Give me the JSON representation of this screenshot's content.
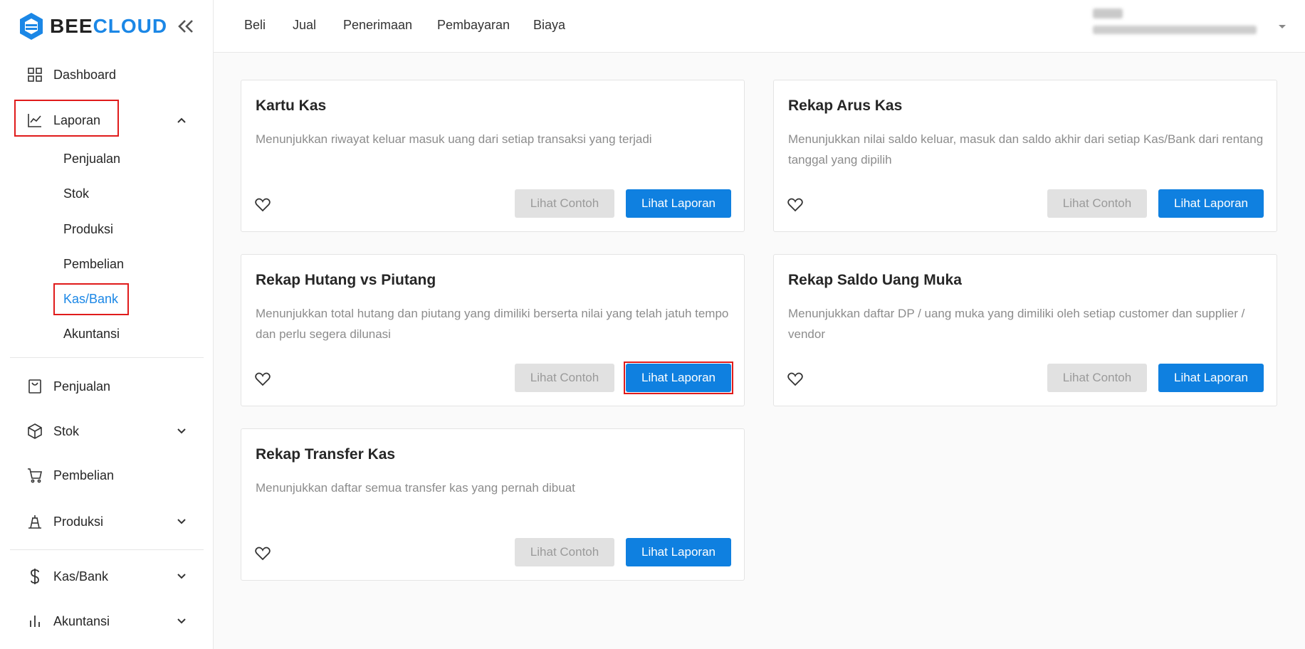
{
  "logo": {
    "part1": "BEE",
    "part2": "CLOUD"
  },
  "sidebar": {
    "items": [
      {
        "label": "Dashboard"
      },
      {
        "label": "Laporan"
      },
      {
        "label": "Penjualan"
      },
      {
        "label": "Stok"
      },
      {
        "label": "Pembelian"
      },
      {
        "label": "Produksi"
      },
      {
        "label": "Kas/Bank"
      },
      {
        "label": "Akuntansi"
      }
    ],
    "laporan_sub": [
      {
        "label": "Penjualan"
      },
      {
        "label": "Stok"
      },
      {
        "label": "Produksi"
      },
      {
        "label": "Pembelian"
      },
      {
        "label": "Kas/Bank",
        "active": true
      },
      {
        "label": "Akuntansi"
      }
    ]
  },
  "topbar": {
    "menu": [
      {
        "label": "Beli"
      },
      {
        "label": "Jual"
      },
      {
        "label": "Penerimaan"
      },
      {
        "label": "Pembayaran"
      },
      {
        "label": "Biaya"
      }
    ]
  },
  "cards": [
    {
      "title": "Kartu Kas",
      "desc": "Menunjukkan riwayat keluar masuk uang dari setiap transaksi yang terjadi",
      "example_label": "Lihat Contoh",
      "report_label": "Lihat Laporan"
    },
    {
      "title": "Rekap Arus Kas",
      "desc": "Menunjukkan nilai saldo keluar, masuk dan saldo akhir dari setiap Kas/Bank dari rentang tanggal yang dipilih",
      "example_label": "Lihat Contoh",
      "report_label": "Lihat Laporan"
    },
    {
      "title": "Rekap Hutang vs Piutang",
      "desc": "Menunjukkan total hutang dan piutang yang dimiliki berserta nilai yang telah jatuh tempo dan perlu segera dilunasi",
      "example_label": "Lihat Contoh",
      "report_label": "Lihat Laporan"
    },
    {
      "title": "Rekap Saldo Uang Muka",
      "desc": "Menunjukkan daftar DP / uang muka yang dimiliki oleh setiap customer dan supplier / vendor",
      "example_label": "Lihat Contoh",
      "report_label": "Lihat Laporan"
    },
    {
      "title": "Rekap Transfer Kas",
      "desc": "Menunjukkan daftar semua transfer kas yang pernah dibuat",
      "example_label": "Lihat Contoh",
      "report_label": "Lihat Laporan"
    }
  ],
  "colors": {
    "accent": "#0f80e0",
    "highlight": "#e01b1b"
  }
}
